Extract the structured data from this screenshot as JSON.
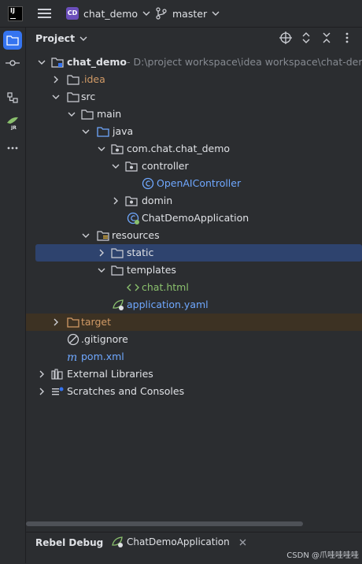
{
  "titlebar": {
    "app_logo": "IJ",
    "project_badge": "CD",
    "project_name": "chat_demo",
    "branch": "master"
  },
  "panel": {
    "title": "Project"
  },
  "tree": {
    "root_name": "chat_demo",
    "root_path": "- D:\\project workspace\\idea workspace\\chat-demo",
    "idea": ".idea",
    "src": "src",
    "main": "main",
    "java": "java",
    "package": "com.chat.chat_demo",
    "controller": "controller",
    "openai_controller": "OpenAIController",
    "domin": "domin",
    "app_class": "ChatDemoApplication",
    "resources": "resources",
    "static": "static",
    "templates": "templates",
    "chat_html": "chat.html",
    "application_yaml": "application.yaml",
    "target": "target",
    "gitignore": ".gitignore",
    "pom": "pom.xml",
    "external_libraries": "External Libraries",
    "scratches": "Scratches and Consoles"
  },
  "bottom": {
    "rebel_debug": "Rebel Debug",
    "run_tab": "ChatDemoApplication"
  },
  "watermark": "CSDN @爪哇哇哇哇",
  "colors": {
    "background": "#2b2d30",
    "selection": "#2e436e",
    "excluded": "#3d3223",
    "accent_blue": "#3574f0",
    "badge_purple": "#6b4fbb"
  }
}
